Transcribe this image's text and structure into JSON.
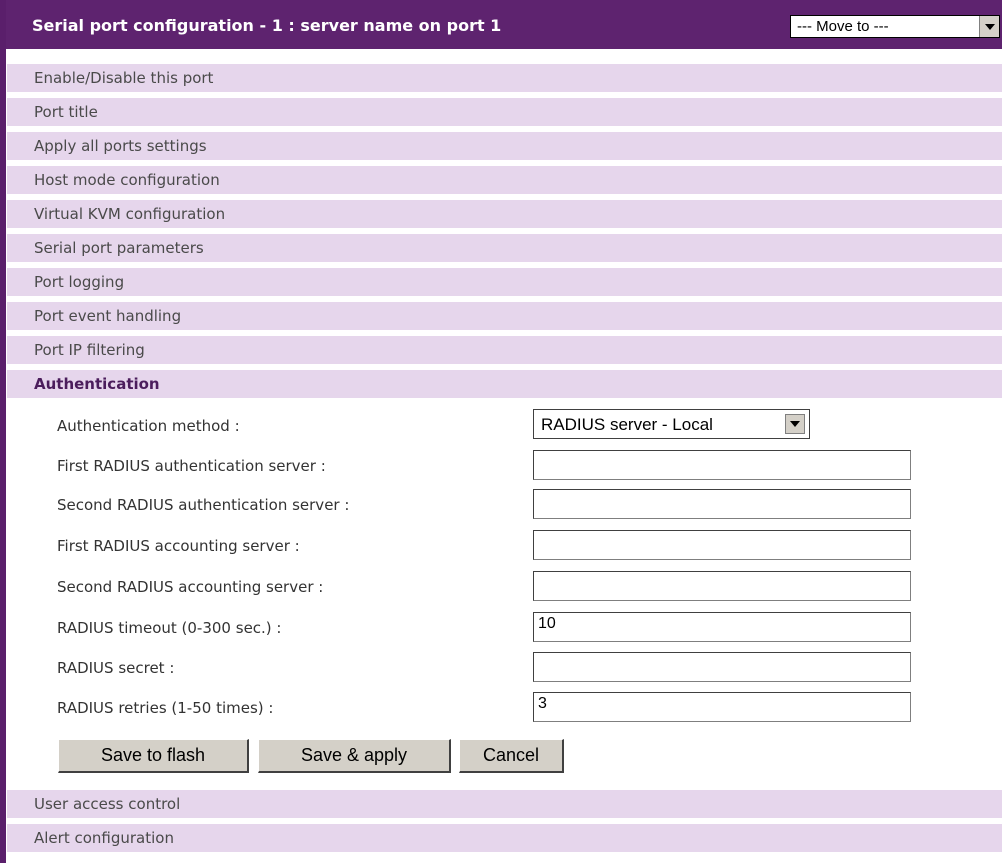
{
  "header": {
    "title": "Serial port configuration - 1 : server name on port 1",
    "move_to": "--- Move to ---"
  },
  "sections": [
    "Enable/Disable this port",
    "Port title",
    "Apply all ports settings",
    "Host mode configuration",
    "Virtual KVM configuration",
    "Serial port parameters",
    "Port logging",
    "Port event handling",
    "Port IP filtering",
    "Authentication"
  ],
  "sections_after": [
    "User access control",
    "Alert configuration"
  ],
  "auth": {
    "method_label": "Authentication method :",
    "method_value": "RADIUS server - Local",
    "first_auth_label": "First RADIUS authentication server :",
    "first_auth_value": "",
    "second_auth_label": "Second RADIUS authentication server :",
    "second_auth_value": "",
    "first_acct_label": "First RADIUS accounting server :",
    "first_acct_value": "",
    "second_acct_label": "Second RADIUS accounting server :",
    "second_acct_value": "",
    "timeout_label": "RADIUS timeout (0-300 sec.) :",
    "timeout_value": "10",
    "secret_label": "RADIUS secret :",
    "secret_value": "",
    "retries_label": "RADIUS retries (1-50 times) :",
    "retries_value": "3"
  },
  "buttons": {
    "save_flash": "Save to flash",
    "save_apply": "Save & apply",
    "cancel": "Cancel"
  },
  "colors": {
    "header_bg": "#5e236f",
    "section_bg": "#e6d6ec"
  }
}
